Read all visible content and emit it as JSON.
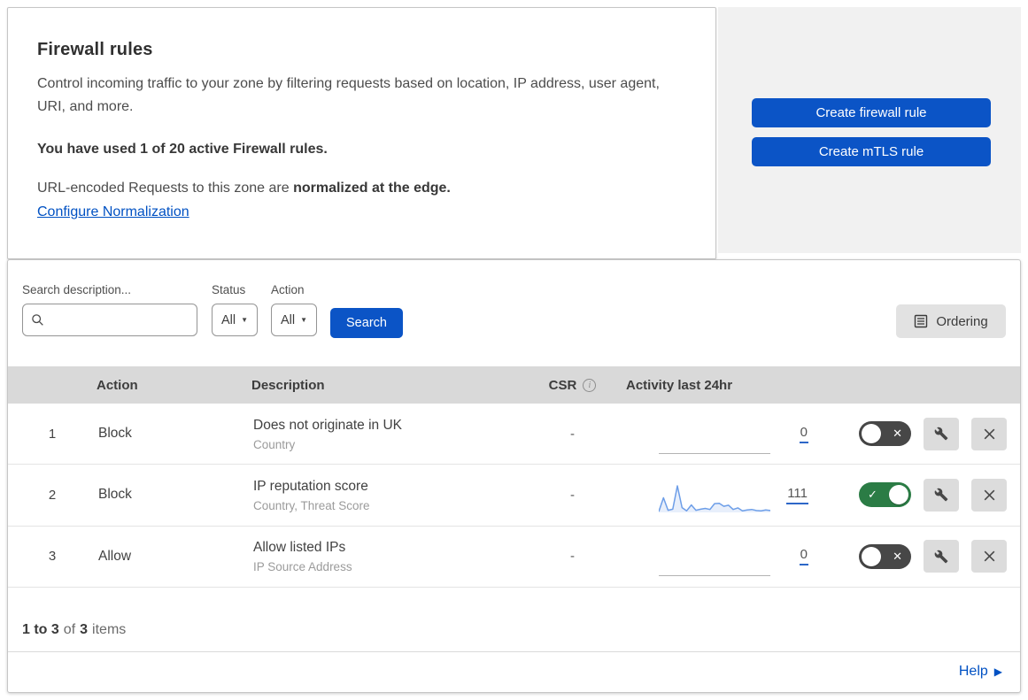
{
  "header": {
    "title": "Firewall rules",
    "description": "Control incoming traffic to your zone by filtering requests based on location, IP address, user agent, URI, and more.",
    "usage_notice": "You have used 1 of 20 active Firewall rules.",
    "normalization_prefix": "URL-encoded Requests to this zone are ",
    "normalization_bold": "normalized at the edge.",
    "normalization_link": "Configure Normalization"
  },
  "actions_panel": {
    "create_firewall_label": "Create firewall rule",
    "create_mtls_label": "Create mTLS rule"
  },
  "filters": {
    "search_label": "Search description...",
    "search_value": "",
    "status_label": "Status",
    "status_value": "All",
    "action_label": "Action",
    "action_value": "All",
    "search_button_label": "Search",
    "ordering_button_label": "Ordering"
  },
  "table": {
    "headers": {
      "action": "Action",
      "description": "Description",
      "csr": "CSR",
      "activity": "Activity last 24hr"
    },
    "rows": [
      {
        "index": "1",
        "action": "Block",
        "description": "Does not originate in UK",
        "fields": "Country",
        "csr": "-",
        "activity_count": "0",
        "enabled": false,
        "sparkline": []
      },
      {
        "index": "2",
        "action": "Block",
        "description": "IP reputation score",
        "fields": "Country, Threat Score",
        "csr": "-",
        "activity_count": "111",
        "enabled": true,
        "sparkline": [
          3,
          55,
          8,
          12,
          100,
          18,
          6,
          28,
          8,
          12,
          15,
          11,
          33,
          34,
          23,
          27,
          11,
          17,
          6,
          9,
          11,
          7,
          6,
          9,
          7
        ]
      },
      {
        "index": "3",
        "action": "Allow",
        "description": "Allow listed IPs",
        "fields": "IP Source Address",
        "csr": "-",
        "activity_count": "0",
        "enabled": false,
        "sparkline": []
      }
    ]
  },
  "footer": {
    "range": "1 to 3",
    "of_text": "of",
    "total": "3",
    "items_text": "items"
  },
  "help": {
    "label": "Help"
  },
  "icons": {
    "search": "magnifier",
    "ordering": "list-page",
    "csr_info": "i",
    "edit": "wrench",
    "delete": "x",
    "caret": "▼",
    "check": "✓",
    "cross": "✕",
    "help_arrow": "▶"
  },
  "colors": {
    "accent_blue": "#0b54c6",
    "link_blue": "#0051c3",
    "toggle_on_green": "#2b7c45",
    "toggle_off_gray": "#474747",
    "sparkline_blue": "#6d9ee8",
    "table_header_gray": "#d9d9d9",
    "panel_gray": "#f1f1f1"
  }
}
